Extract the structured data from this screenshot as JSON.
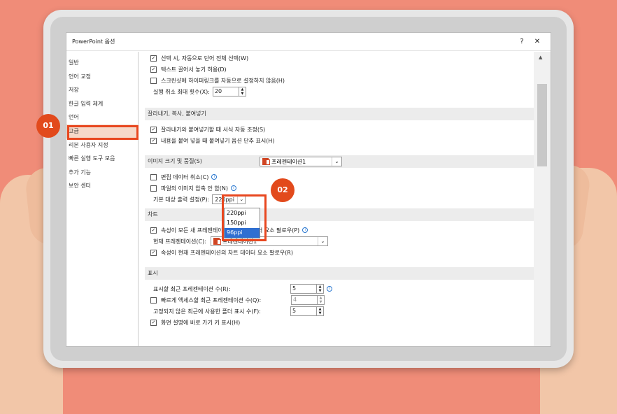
{
  "window": {
    "title": "PowerPoint 옵션",
    "help_label": "?",
    "close_label": "✕"
  },
  "sidebar": {
    "items": [
      {
        "label": "일반"
      },
      {
        "label": "언어 교정"
      },
      {
        "label": "저장"
      },
      {
        "label": "한글 입력 체계"
      },
      {
        "label": "언어"
      },
      {
        "label": "고급",
        "active": true
      },
      {
        "label": "리본 사용자 지정"
      },
      {
        "label": "빠른 실행 도구 모음"
      },
      {
        "label": "추가 기능"
      },
      {
        "label": "보안 센터"
      }
    ]
  },
  "content": {
    "top_cut": "선택 시, 자동으로 단어 전체 선택(W)",
    "drag_drop": "텍스트 끌어서 놓기 허용(D)",
    "no_hyperlink": "스크린샷에 하이퍼링크를 자동으로 설정하지 않음(H)",
    "undo_label": "실행 취소 최대 횟수(X):",
    "undo_value": "20",
    "section_cut_paste": "잘라내기, 복사, 붙여넣기",
    "smart_cut": "잘라내기와 붙여넣기할 때 서식 자동 조정(S)",
    "paste_options": "내용을 붙여 넣을 때 붙여넣기 옵션 단추 표시(H)",
    "section_image": "이미지 크기 및 품질(S)",
    "presentation_name": "프레젠테이션1",
    "discard_edit": "편집 데이터 취소(C)",
    "no_compress": "파일의 이미지 압축 안 함(N)",
    "default_output": "기본 대상 출력 설정(P):",
    "ppi_selected": "220ppi",
    "ppi_options": [
      "220ppi",
      "150ppi",
      "96ppi"
    ],
    "ppi_highlighted": "96ppi",
    "section_chart": "차트",
    "chart_props_new": "속성이 모든 새 프레젠테이션의 차트 데이터 요소 팔로우(P)",
    "chart_props_new_hidden_part": "젠테이션의 차",
    "current_presentation": "현재 프레젠테이션(C):",
    "chart_props_current": "속성이 현재 프레젠테이션의 차트 데이터 요소 팔로우(R)",
    "section_display": "표시",
    "recent_count_label": "표시할 최근 프레젠테이션 수(R):",
    "recent_count_value": "5",
    "quick_access_label": "빠르게 액세스할 최근 프레젠테이션 수(Q):",
    "quick_access_value": "4",
    "unpinned_folders_label": "고정되지 않은 최근에 사용한 폴더 표시 수(F):",
    "unpinned_folders_value": "5",
    "shortcut_keys": "화면 설명에 바로 가기 키 표시(H)"
  },
  "steps": {
    "one": "01",
    "two": "02"
  }
}
